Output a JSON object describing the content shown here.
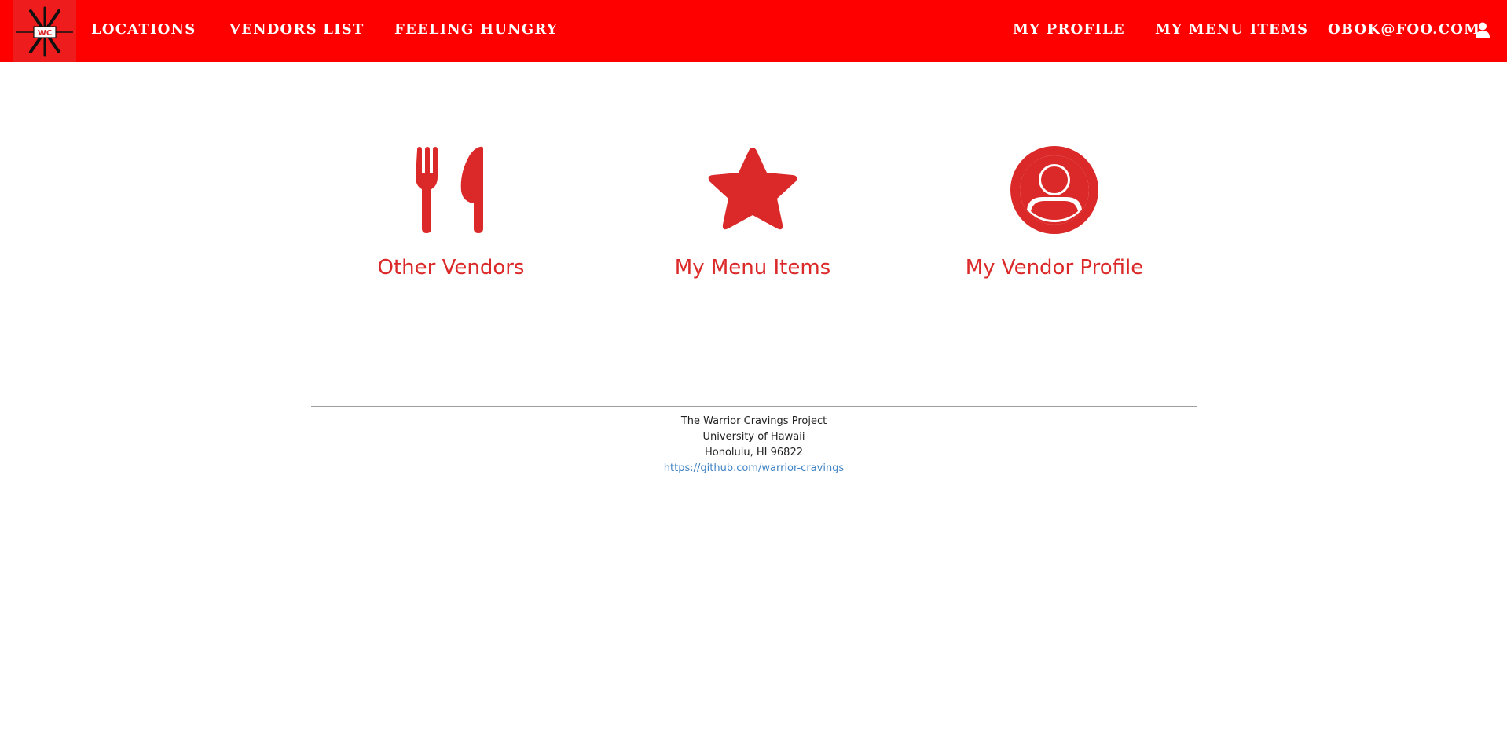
{
  "colors": {
    "navbar_bg": "#ff0000",
    "accent": "#db2828",
    "link": "#4183c4"
  },
  "nav": {
    "logo_text": "WC",
    "left_links": [
      {
        "label": "LOCATIONS"
      },
      {
        "label": "VENDORS LIST"
      },
      {
        "label": "FEELING HUNGRY"
      }
    ],
    "right_links": [
      {
        "label": "MY PROFILE"
      },
      {
        "label": "MY MENU ITEMS"
      },
      {
        "label": "OBOK@FOO.COM",
        "icon": "user-icon"
      }
    ]
  },
  "tiles": [
    {
      "label": "Other Vendors",
      "icon": "utensils-icon"
    },
    {
      "label": "My Menu Items",
      "icon": "star-icon"
    },
    {
      "label": "My Vendor Profile",
      "icon": "user-circle-icon"
    }
  ],
  "footer": {
    "line1": "The Warrior Cravings Project",
    "line2": "University of Hawaii",
    "line3": "Honolulu, HI 96822",
    "link": "https://github.com/warrior-cravings"
  }
}
